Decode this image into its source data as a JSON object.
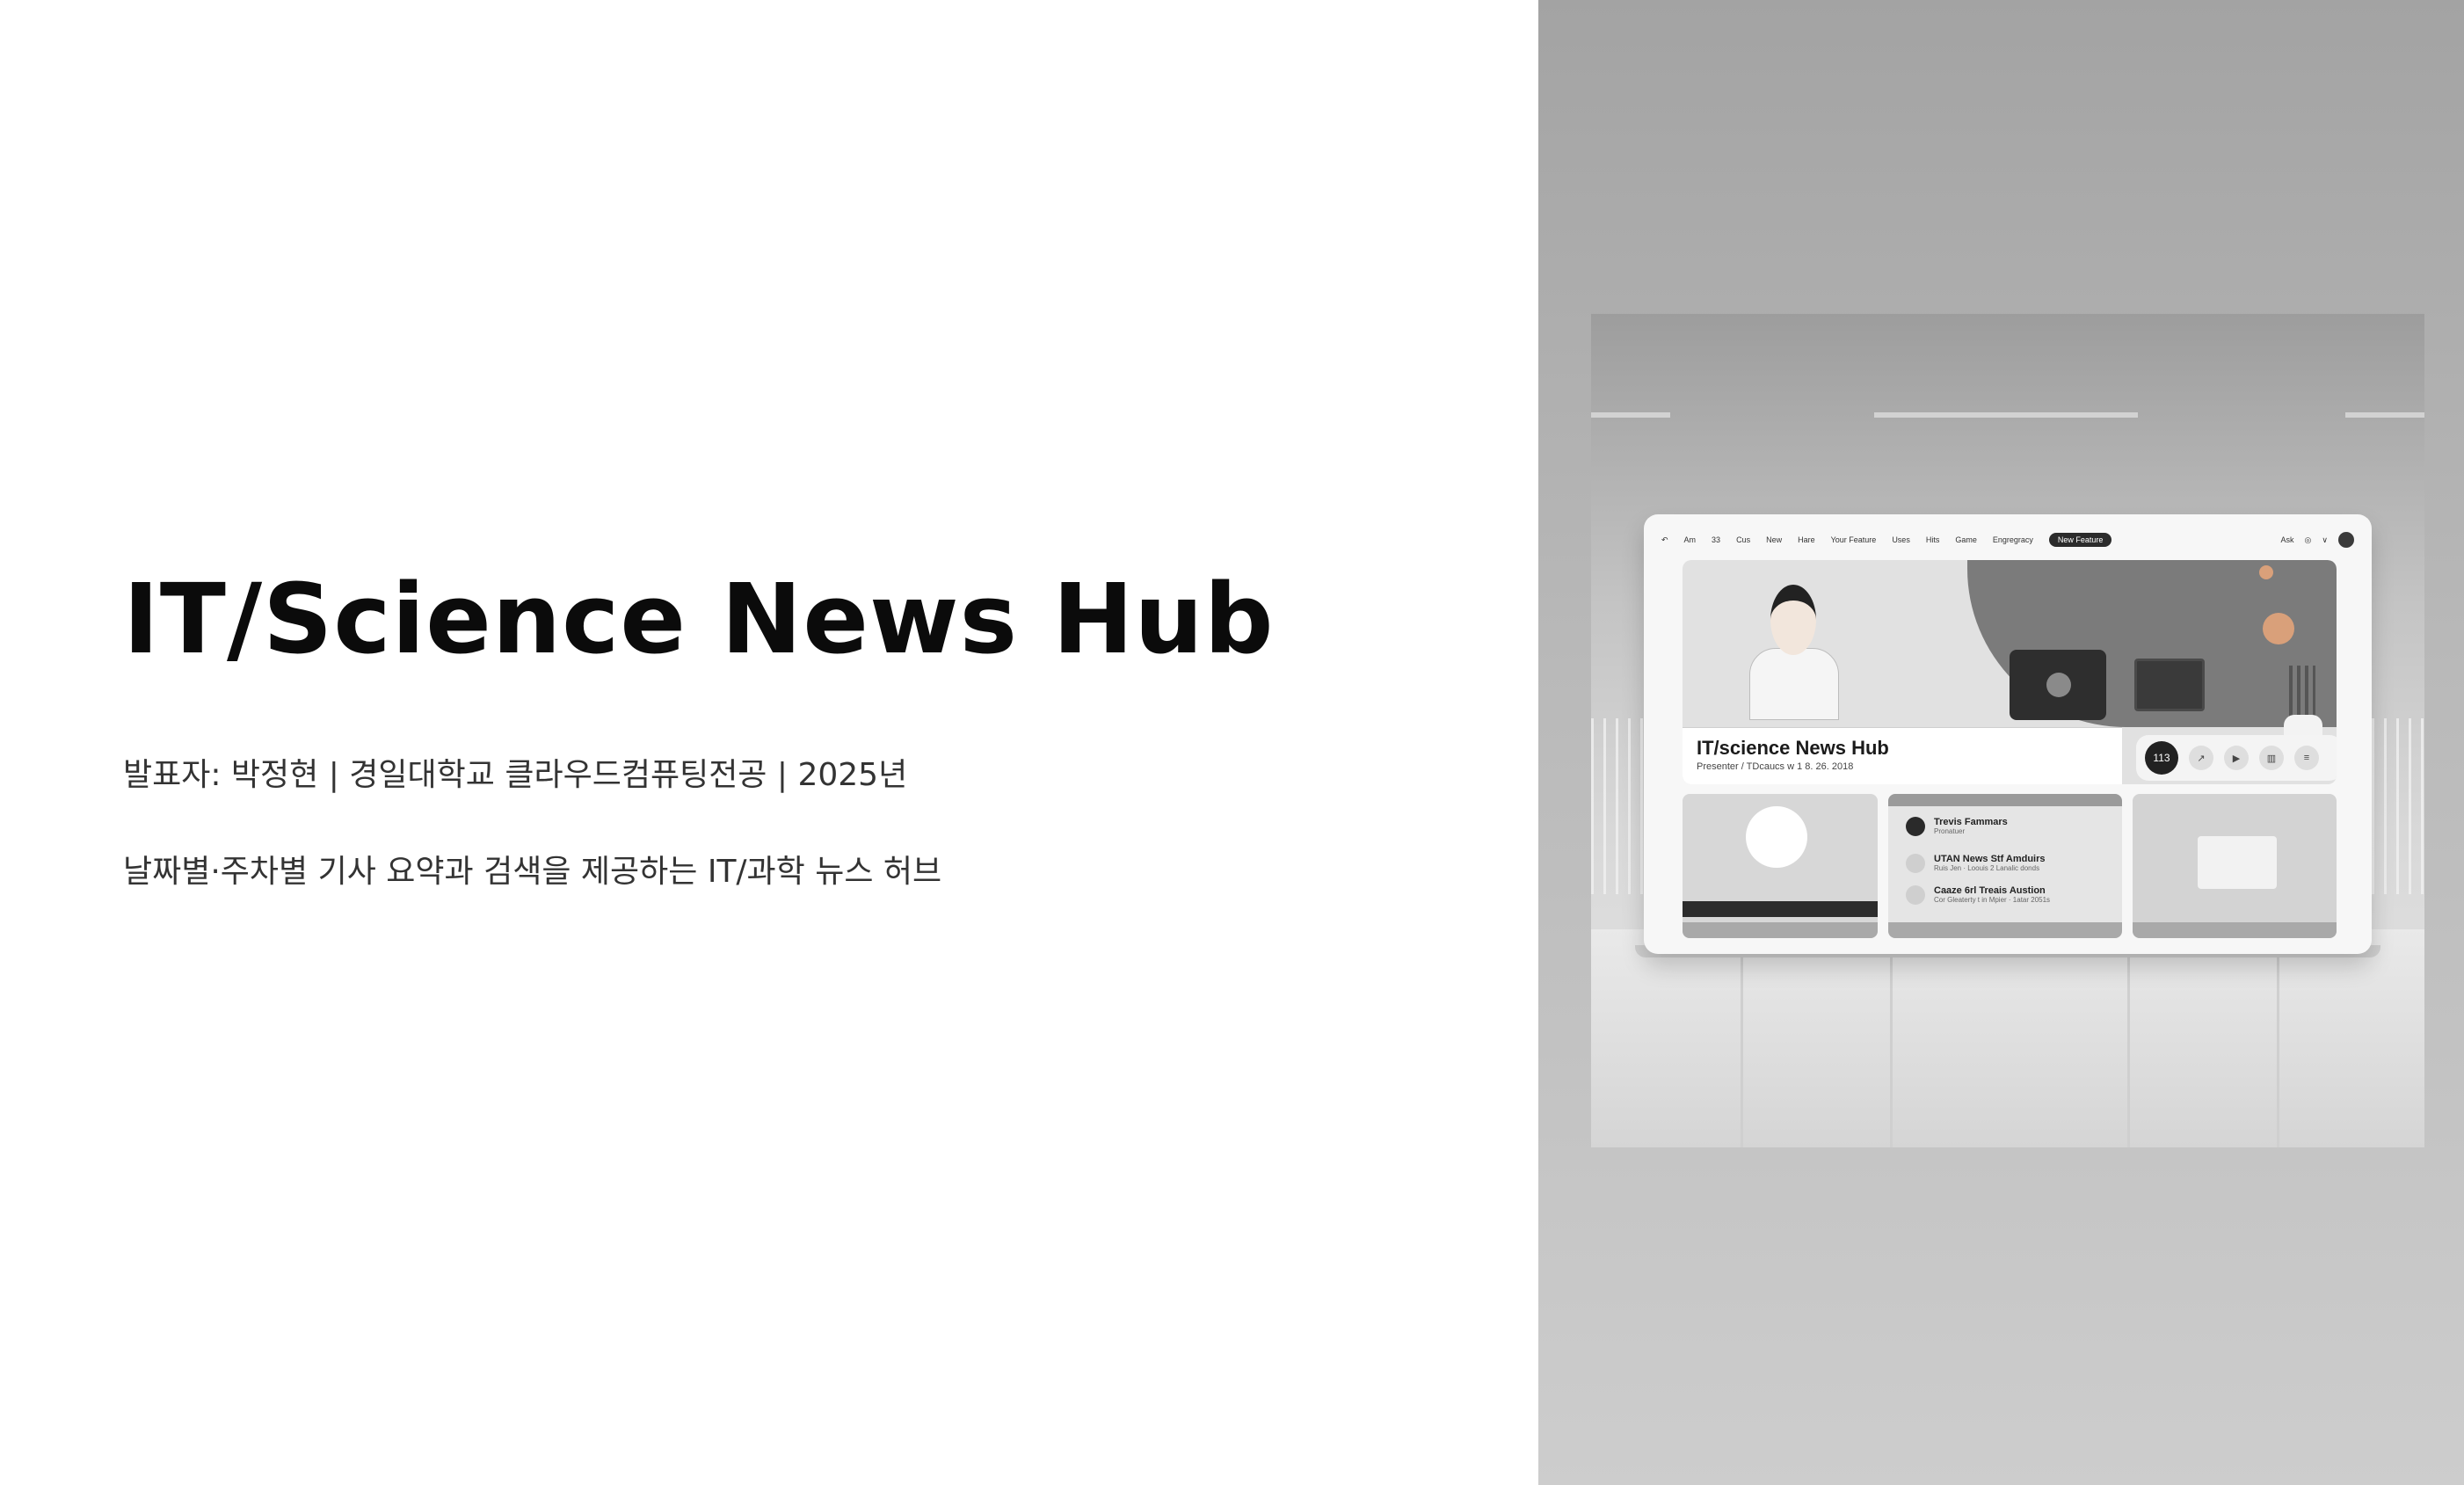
{
  "slide": {
    "title": "IT/Science News Hub",
    "subtitle": "발표자: 박정현 | 경일대학교 클라우드컴퓨팅전공 | 2025년",
    "description": "날짜별·주차별 기사 요약과 검색을 제공하는 IT/과학 뉴스 허브"
  },
  "illustration": {
    "nav": {
      "items": [
        "Am",
        "33",
        "Cus",
        "New",
        "Hare",
        "Your Feature",
        "Uses",
        "Hits",
        "Game",
        "Engregracy"
      ],
      "pill": "New Feature",
      "right_label": "Ask"
    },
    "hero": {
      "title": "IT/science News Hub",
      "subtitle": "Presenter / TDcaucs w 1 8. 26. 2018",
      "controls": [
        "113"
      ]
    },
    "list": [
      {
        "title": "Trevis Fammars",
        "sub": "Pronatuer"
      },
      {
        "title": "UTAN News Stf Amduirs",
        "sub": "Ruis Jen · Loouis 2 Lanalic donds"
      },
      {
        "title": "Caaze 6rl Treais Austion",
        "sub": "Cor Gleaterty t in Mpier · 1atar 2051s"
      }
    ]
  },
  "colors": {
    "background": "#ffffff",
    "panel": "#b9b9b9",
    "title_text": "#0b0b0b",
    "body_text": "#333333"
  }
}
